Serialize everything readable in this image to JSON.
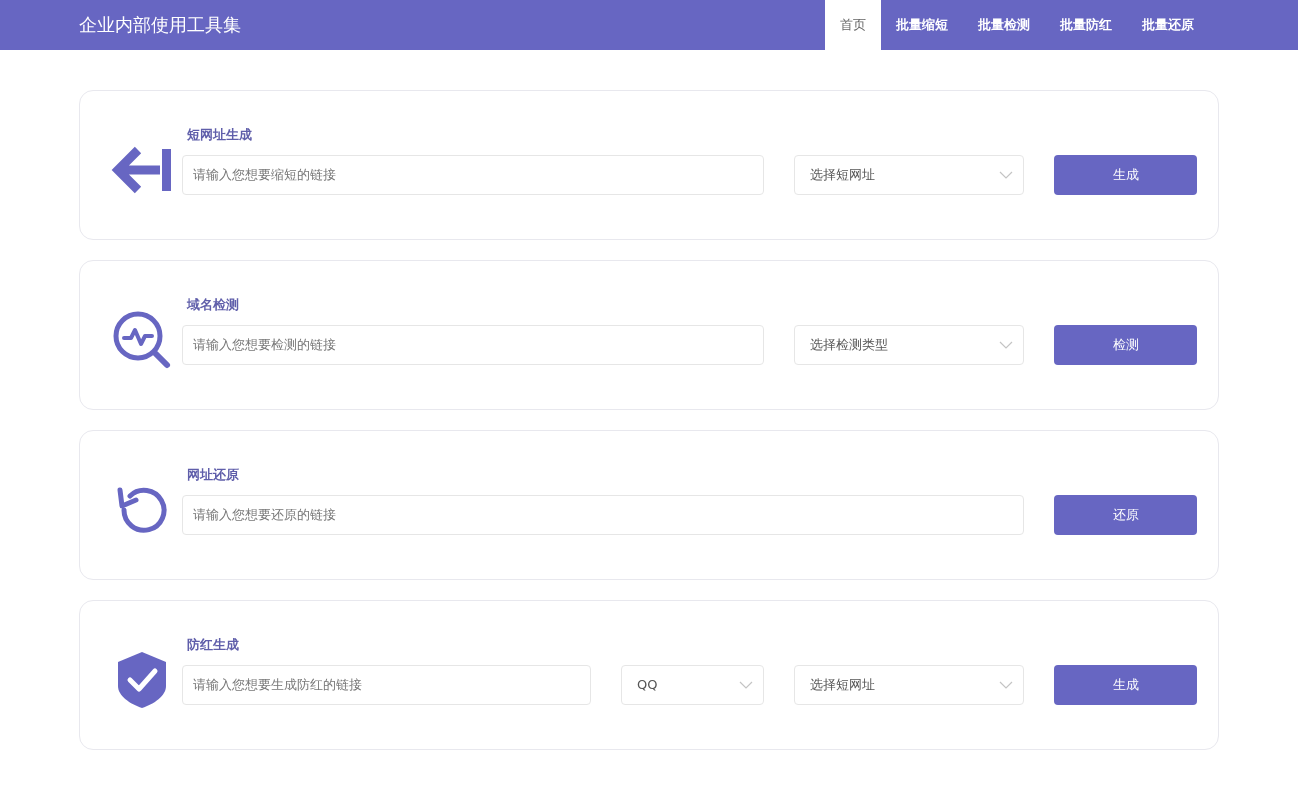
{
  "header": {
    "title": "企业内部使用工具集",
    "tabs": [
      {
        "label": "首页",
        "selected": true
      },
      {
        "label": "批量缩短",
        "selected": false
      },
      {
        "label": "批量检测",
        "selected": false
      },
      {
        "label": "批量防红",
        "selected": false
      },
      {
        "label": "批量还原",
        "selected": false
      }
    ]
  },
  "cards": [
    {
      "kind": "shorten",
      "title": "短网址生成",
      "placeholder": "请输入您想要缩短的链接",
      "selects": [
        {
          "value": "选择短网址"
        }
      ],
      "button": "生成"
    },
    {
      "kind": "check",
      "title": "域名检测",
      "placeholder": "请输入您想要检测的链接",
      "selects": [
        {
          "value": "选择检测类型"
        }
      ],
      "button": "检测"
    },
    {
      "kind": "restore",
      "title": "网址还原",
      "placeholder": "请输入您想要还原的链接",
      "button": "还原"
    },
    {
      "kind": "protect",
      "title": "防红生成",
      "placeholder": "请输入您想要生成防红的链接",
      "selects": [
        {
          "value": "QQ"
        },
        {
          "value": "选择短网址"
        }
      ],
      "button": "生成"
    }
  ]
}
